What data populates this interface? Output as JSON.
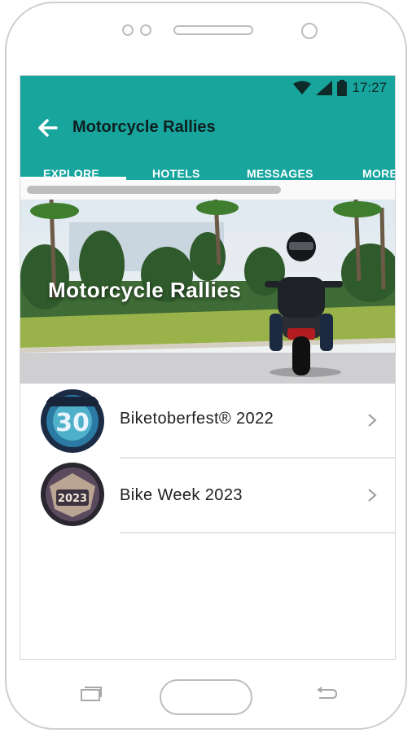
{
  "status": {
    "time": "17:27"
  },
  "appbar": {
    "title": "Motorcycle Rallies"
  },
  "tabs": [
    {
      "label": "EXPLORE"
    },
    {
      "label": "HOTELS"
    },
    {
      "label": "MESSAGES"
    },
    {
      "label": "MORE"
    }
  ],
  "hero": {
    "title": "Motorcycle Rallies"
  },
  "list": {
    "items": [
      {
        "label": "Biketoberfest® 2022",
        "logo_text": "30"
      },
      {
        "label": "Bike Week 2023",
        "logo_text": "2023"
      }
    ]
  },
  "colors": {
    "accent": "#17a59e",
    "text": "#202020"
  },
  "icons": [
    "back-arrow-icon",
    "wifi-icon",
    "signal-icon",
    "battery-icon",
    "chevron-right-icon",
    "recent-apps-icon",
    "home-button",
    "android-back-icon"
  ]
}
